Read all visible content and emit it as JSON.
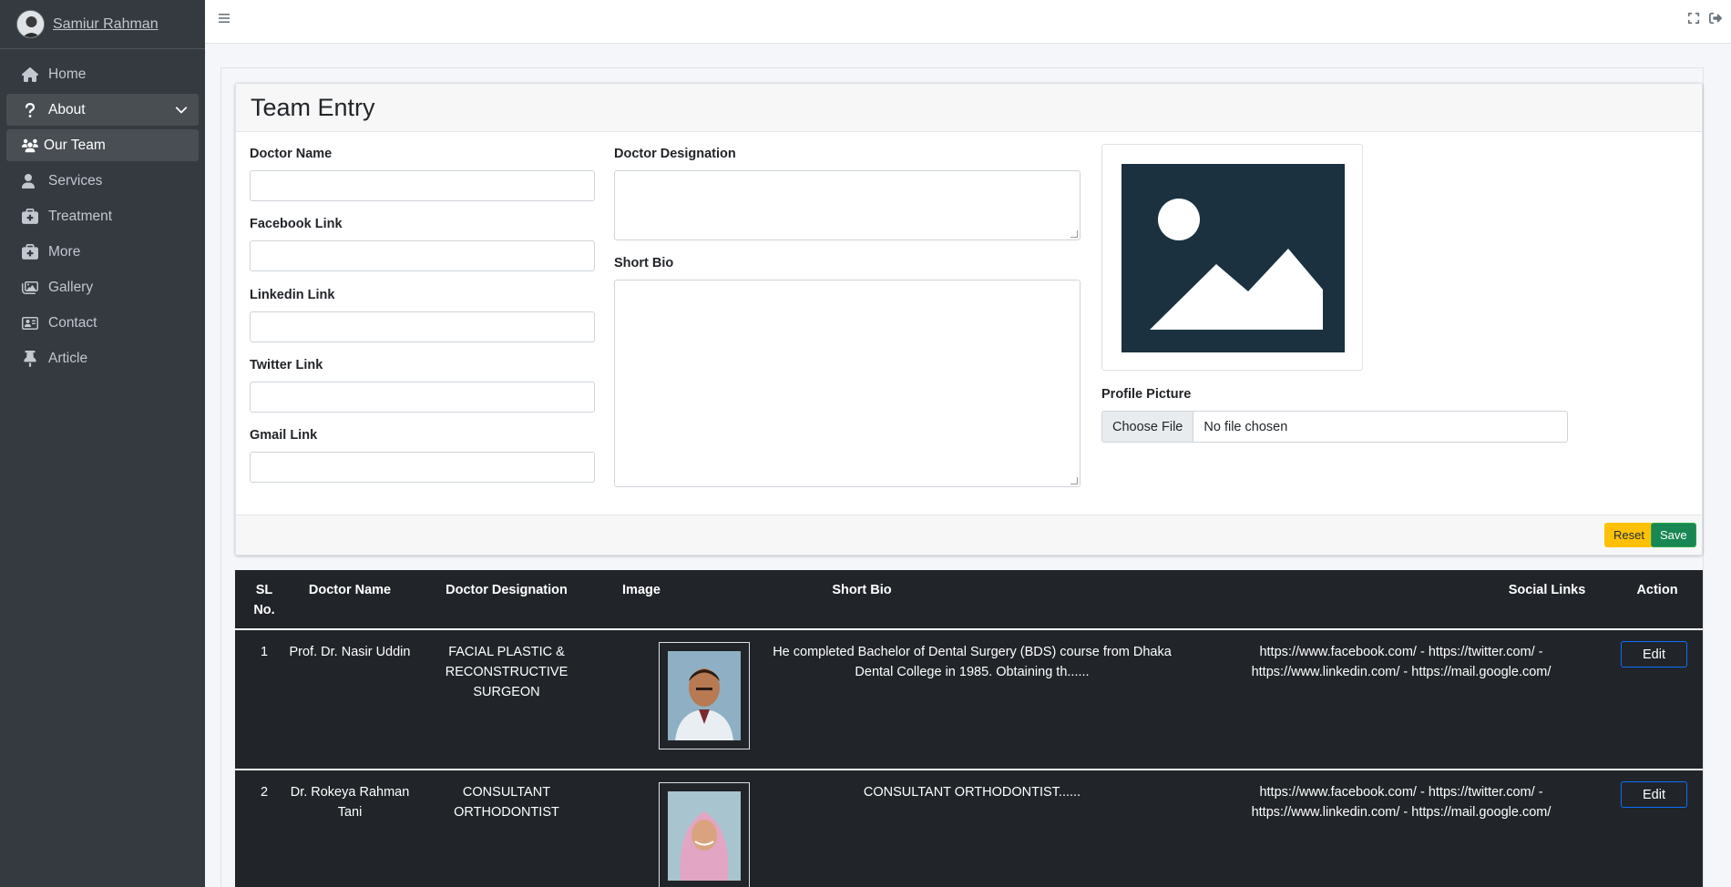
{
  "user": {
    "name": "Samiur Rahman"
  },
  "sidebar": {
    "items": [
      {
        "label": "Home",
        "icon": "home-icon"
      },
      {
        "label": "About",
        "icon": "question-icon"
      },
      {
        "label": "Our Team",
        "icon": "users-icon"
      },
      {
        "label": "Services",
        "icon": "user-service-icon"
      },
      {
        "label": "Treatment",
        "icon": "medkit-icon"
      },
      {
        "label": "More",
        "icon": "medkit-icon"
      },
      {
        "label": "Gallery",
        "icon": "images-icon"
      },
      {
        "label": "Contact",
        "icon": "contact-card-icon"
      },
      {
        "label": "Article",
        "icon": "thumbtack-icon"
      }
    ]
  },
  "form": {
    "title": "Team Entry",
    "doctor_name_label": "Doctor Name",
    "facebook_label": "Facebook Link",
    "linkedin_label": "Linkedin Link",
    "twitter_label": "Twitter Link",
    "gmail_label": "Gmail Link",
    "designation_label": "Doctor Designation",
    "bio_label": "Short Bio",
    "picture_label": "Profile Picture",
    "choose_file": "Choose File",
    "no_file": "No file chosen",
    "reset": "Reset",
    "save": "Save"
  },
  "table": {
    "headers": {
      "sl": "SL No.",
      "name": "Doctor Name",
      "designation": "Doctor Designation",
      "image": "Image",
      "bio": "Short Bio",
      "links": "Social Links",
      "action": "Action"
    },
    "rows": [
      {
        "sl": "1",
        "name": "Prof. Dr. Nasir Uddin",
        "designation": "FACIAL PLASTIC & RECONSTRUCTIVE SURGEON",
        "bio": "He completed Bachelor of Dental Surgery (BDS) course from Dhaka Dental College in 1985. Obtaining th......",
        "links": "https://www.facebook.com/ - https://twitter.com/ - https://www.linkedin.com/ - https://mail.google.com/",
        "action": "Edit"
      },
      {
        "sl": "2",
        "name": "Dr. Rokeya Rahman Tani",
        "designation": "CONSULTANT ORTHODONTIST",
        "bio": "CONSULTANT ORTHODONTIST......",
        "links": "https://www.facebook.com/ - https://twitter.com/ - https://www.linkedin.com/ - https://mail.google.com/",
        "action": "Edit"
      }
    ]
  },
  "colors": {
    "sidebar_bg": "#343a40",
    "table_bg": "#212529",
    "reset_btn": "#ffc107",
    "save_btn": "#198754",
    "placeholder_dark": "#1b313f"
  }
}
